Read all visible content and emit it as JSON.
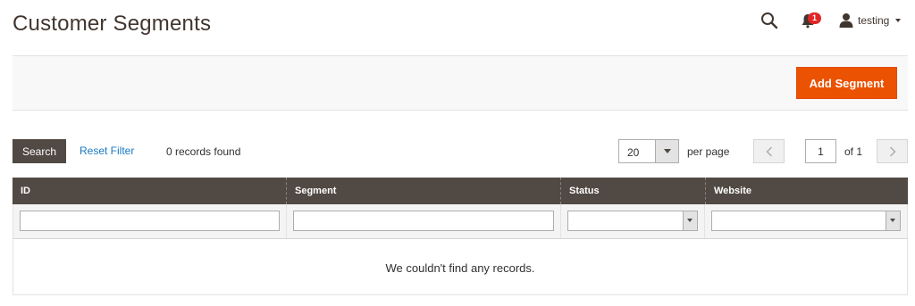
{
  "header": {
    "title": "Customer Segments",
    "notification_count": "1",
    "username": "testing"
  },
  "actions": {
    "add_label": "Add Segment"
  },
  "toolbar": {
    "search_label": "Search",
    "reset_label": "Reset Filter",
    "records_text": "0 records found",
    "per_page_value": "20",
    "per_page_label": "per page",
    "current_page": "1",
    "page_total": "of 1"
  },
  "grid": {
    "columns": [
      "ID",
      "Segment",
      "Status",
      "Website"
    ],
    "empty_message": "We couldn't find any records."
  },
  "colors": {
    "primary_button": "#eb5202",
    "grid_header": "#514943",
    "link": "#1979c3",
    "badge": "#e22626"
  },
  "icons": [
    "search-icon",
    "bell-icon",
    "user-icon",
    "chevron-left-icon",
    "chevron-right-icon"
  ]
}
